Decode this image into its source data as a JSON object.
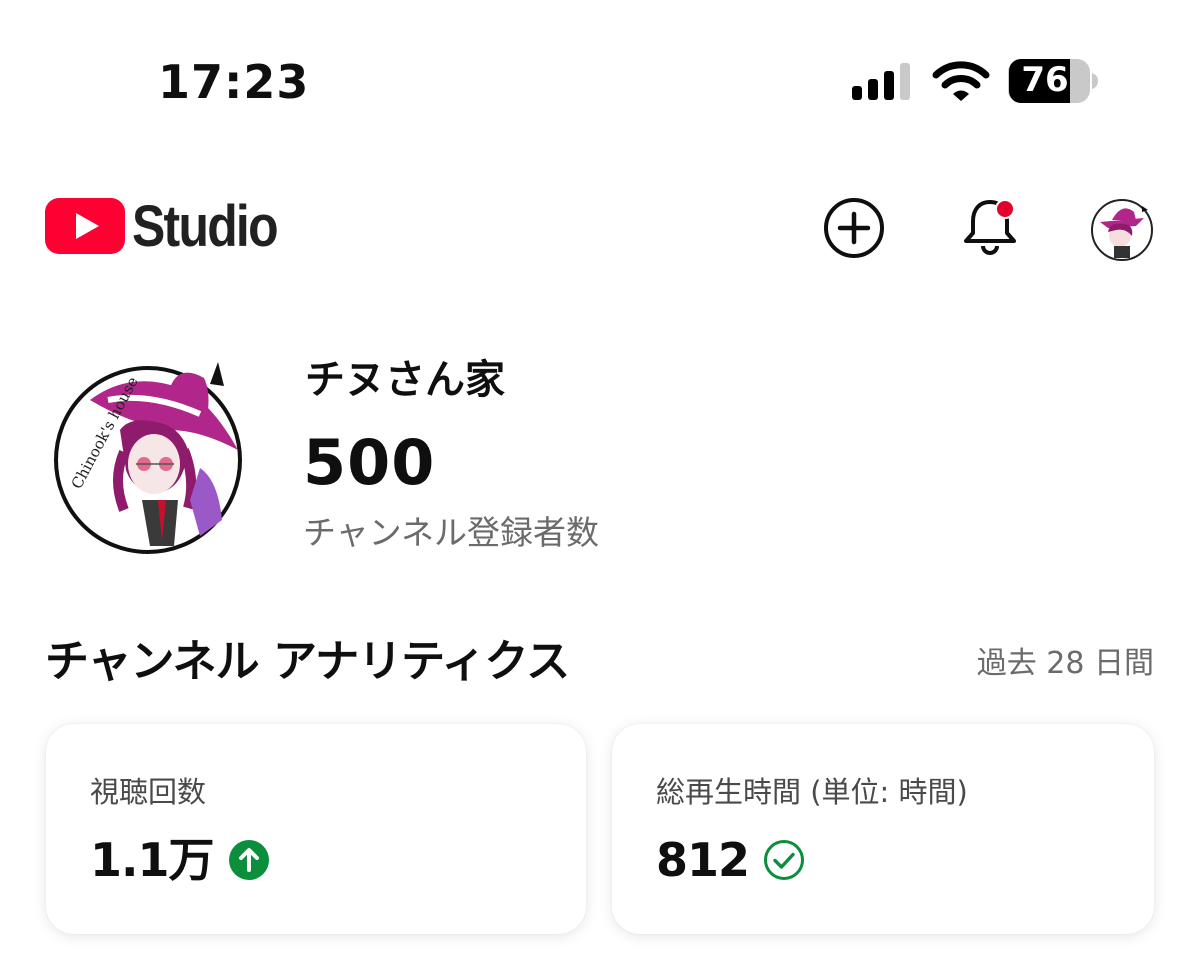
{
  "status_bar": {
    "time": "17:23",
    "battery_level": "76",
    "icons": [
      "signal-icon",
      "wifi-icon",
      "battery-icon"
    ]
  },
  "header": {
    "logo_icon": "youtube-play-icon",
    "logo_text": "Studio",
    "actions": [
      "create-icon",
      "notification-bell-icon",
      "account-avatar"
    ],
    "notification_dot_color": "#ff0000"
  },
  "channel": {
    "name": "チヌさん家",
    "subscriber_count": "500",
    "subscriber_label": "チャンネル登録者数",
    "avatar_text": "Chinook's house"
  },
  "analytics": {
    "title": "チャンネル アナリティクス",
    "period": "過去 28 日間",
    "cards": [
      {
        "label": "視聴回数",
        "value": "1.1万",
        "status_icon": "arrow-up-circle-icon",
        "status_color": "#0b8f3c"
      },
      {
        "label": "総再生時間 (単位: 時間)",
        "value": "812",
        "status_icon": "check-circle-icon",
        "status_color": "#0b8f3c"
      }
    ]
  },
  "colors": {
    "brand_red": "#ff0033",
    "text_primary": "#0f0f0f",
    "text_secondary": "#6b6b6b",
    "positive_green": "#0b8f3c",
    "avatar_magenta": "#b0268a"
  }
}
